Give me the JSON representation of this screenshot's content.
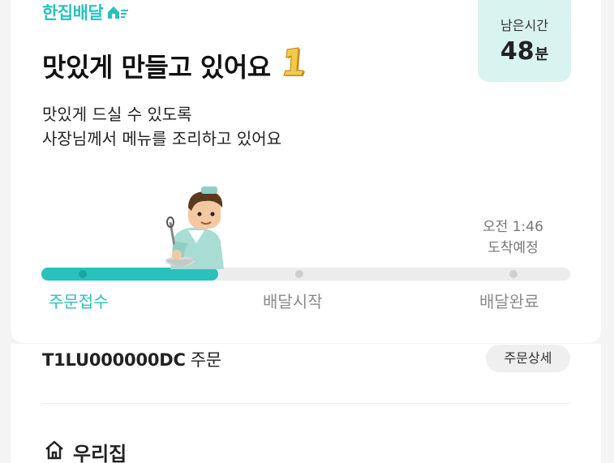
{
  "brand": {
    "name": "한집배달"
  },
  "status": {
    "title": "맛있게 만들고 있어요",
    "subtitle_line1": "맛있게 드실 수 있도록",
    "subtitle_line2": "사장님께서 메뉴를 조리하고 있어요"
  },
  "remaining": {
    "label": "남은시간",
    "value": "48",
    "unit": "분"
  },
  "eta": {
    "time": "오전 1:46",
    "label": "도착예정"
  },
  "progress": {
    "fraction": 0.335,
    "steps": [
      {
        "label": "주문접수",
        "active": true
      },
      {
        "label": "배달시작",
        "active": false
      },
      {
        "label": "배달완료",
        "active": false
      }
    ]
  },
  "order": {
    "id": "T1LU000000DC",
    "suffix": "주문",
    "detail_button": "주문상세"
  },
  "address": {
    "label": "우리집"
  },
  "colors": {
    "accent": "#2ac1bc",
    "time_box_bg": "#d9f3f0",
    "track": "#ececec"
  },
  "icons": [
    "brand-logo-icon",
    "gold-badge-icon",
    "chef-illustration",
    "home-icon"
  ]
}
